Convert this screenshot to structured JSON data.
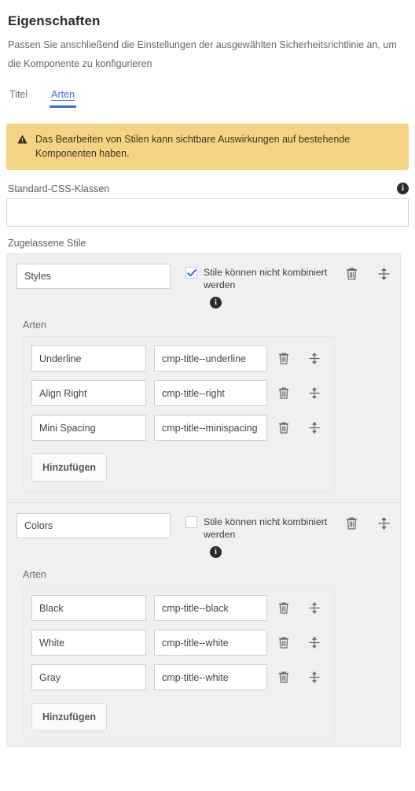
{
  "header": {
    "title": "Eigenschaften",
    "description": "Passen Sie anschließend die Einstellungen der ausgewählten Sicherheitsrichtlinie an, um die Komponente zu konfigurieren"
  },
  "tabs": [
    {
      "label": "Titel",
      "active": false
    },
    {
      "label": "Arten",
      "active": true
    }
  ],
  "warning": {
    "icon": "warning-triangle-icon",
    "text": "Das Bearbeiten von Stilen kann sichtbare Auswirkungen auf bestehende Komponenten haben.",
    "background_color": "#f4d484"
  },
  "default_css": {
    "label": "Standard-CSS-Klassen",
    "info_icon": "info-icon",
    "value": "",
    "placeholder": ""
  },
  "allowed_styles": {
    "label": "Zugelassene Stile",
    "groups": [
      {
        "name_value": "Styles",
        "name_placeholder": "",
        "combine_label": "Stile können nicht kombiniert werden",
        "combine_checked": true,
        "info_icon": "info-icon",
        "delete_icon": "trash-icon",
        "move_icon": "move-vertical-icon",
        "styles_label": "Arten",
        "styles": [
          {
            "name": "Underline",
            "css_class": "cmp-title--underline"
          },
          {
            "name": "Align Right",
            "css_class": "cmp-title--right"
          },
          {
            "name": "Mini Spacing",
            "css_class": "cmp-title--minispacing"
          }
        ],
        "add_label": "Hinzufügen"
      },
      {
        "name_value": "Colors",
        "name_placeholder": "",
        "combine_label": "Stile können nicht kombiniert werden",
        "combine_checked": false,
        "info_icon": "info-icon",
        "delete_icon": "trash-icon",
        "move_icon": "move-vertical-icon",
        "styles_label": "Arten",
        "styles": [
          {
            "name": "Black",
            "css_class": "cmp-title--black"
          },
          {
            "name": "White",
            "css_class": "cmp-title--white"
          },
          {
            "name": "Gray",
            "css_class": "cmp-title--white"
          }
        ],
        "add_label": "Hinzufügen"
      }
    ]
  },
  "colors": {
    "accent": "#3b6fc4",
    "warning_bg": "#f4d484",
    "panel_bg": "#f0f0f0",
    "text": "#333333"
  }
}
